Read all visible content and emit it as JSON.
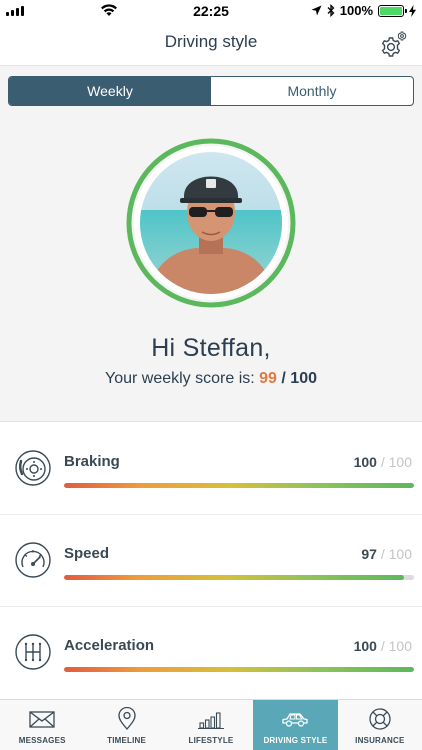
{
  "status_bar": {
    "time": "22:25",
    "battery": "100%"
  },
  "nav": {
    "title": "Driving style",
    "settings_icon": "gear-icon"
  },
  "period_tabs": [
    {
      "label": "Weekly",
      "selected": true
    },
    {
      "label": "Monthly",
      "selected": false
    }
  ],
  "profile": {
    "greeting": "Hi Steffan,",
    "score_prefix": "Your weekly score is:",
    "score": "99",
    "score_max": "/ 100",
    "ring_color": "#5cb85c"
  },
  "metrics": [
    {
      "name": "Braking",
      "value": "100",
      "max": "/ 100",
      "fraction": 1.0,
      "icon": "brake-disc-icon"
    },
    {
      "name": "Speed",
      "value": "97",
      "max": "/ 100",
      "fraction": 0.97,
      "icon": "speedometer-icon"
    },
    {
      "name": "Acceleration",
      "value": "100",
      "max": "/ 100",
      "fraction": 1.0,
      "icon": "gear-shift-icon"
    }
  ],
  "tabs": [
    {
      "label": "MESSAGES",
      "icon": "envelope-icon",
      "active": false
    },
    {
      "label": "TIMELINE",
      "icon": "map-pin-icon",
      "active": false
    },
    {
      "label": "LIFESTYLE",
      "icon": "bar-chart-icon",
      "active": false
    },
    {
      "label": "DRIVING STYLE",
      "icon": "car-icon",
      "active": true
    },
    {
      "label": "INSURANCE",
      "icon": "lifebuoy-icon",
      "active": false
    }
  ],
  "colors": {
    "primary": "#3b5d72",
    "accent": "#e27a3f",
    "tab_active": "#5aa7b7",
    "good": "#5cb85c"
  }
}
